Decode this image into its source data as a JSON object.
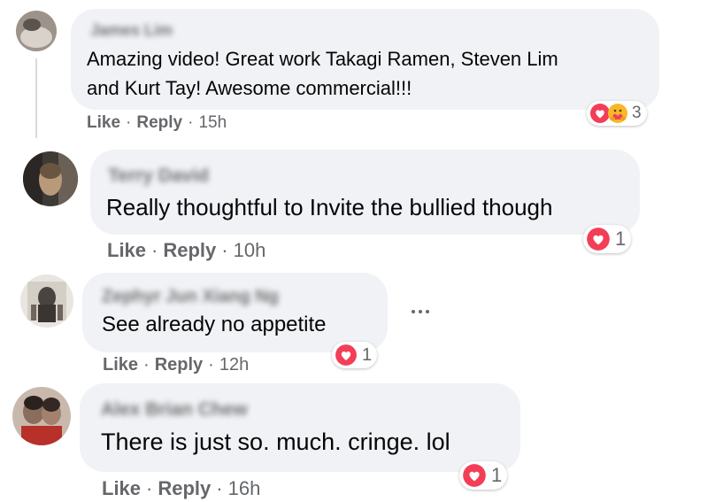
{
  "comments": [
    {
      "author": "James Lim",
      "text_lines": [
        "Amazing video! Great work Takagi Ramen, Steven Lim",
        "and Kurt Tay! Awesome commercial!!!"
      ],
      "like_label": "Like",
      "reply_label": "Reply",
      "time": "15h",
      "reaction_icons": [
        "love-icon",
        "care-icon"
      ],
      "reaction_count": "3"
    },
    {
      "author": "Terry David",
      "text_lines": [
        "Really thoughtful to Invite the bullied though"
      ],
      "like_label": "Like",
      "reply_label": "Reply",
      "time": "10h",
      "reaction_icons": [
        "love-icon"
      ],
      "reaction_count": "1"
    },
    {
      "author": "Zephyr Jun Xiang Ng",
      "text_lines": [
        "See already no appetite"
      ],
      "like_label": "Like",
      "reply_label": "Reply",
      "time": "12h",
      "reaction_icons": [
        "love-icon"
      ],
      "reaction_count": "1"
    },
    {
      "author": "Alex Brian Chew",
      "text_lines": [
        "There is just so. much. cringe. lol"
      ],
      "like_label": "Like",
      "reply_label": "Reply",
      "time": "16h",
      "reaction_icons": [
        "love-icon"
      ],
      "reaction_count": "1"
    }
  ],
  "separator": "·",
  "colors": {
    "bubble": "#f0f2f5",
    "meta_text": "#65676b",
    "love_red": "#f33e58",
    "care_yellow": "#f7b928"
  }
}
